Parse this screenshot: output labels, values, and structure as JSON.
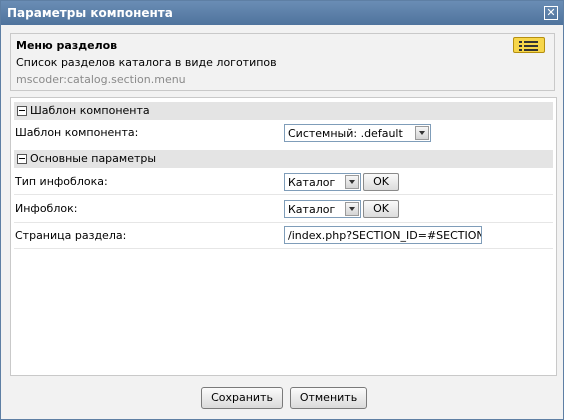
{
  "window": {
    "title": "Параметры компонента",
    "close_glyph": "✕"
  },
  "component": {
    "name": "Меню разделов",
    "description": "Список разделов каталога в виде логотипов",
    "code": "mscoder:catalog.section.menu"
  },
  "groups": [
    {
      "label": "Шаблон компонента",
      "params": [
        {
          "label": "Шаблон компонента:",
          "type": "select",
          "value": "Системный: .default"
        }
      ]
    },
    {
      "label": "Основные параметры",
      "params": [
        {
          "label": "Тип инфоблока:",
          "type": "select_ok",
          "value": "Каталог",
          "button": "OK"
        },
        {
          "label": "Инфоблок:",
          "type": "select_ok",
          "value": "Каталог",
          "button": "OK"
        },
        {
          "label": "Страница раздела:",
          "type": "text",
          "value": "/index.php?SECTION_ID=#SECTION_ID#"
        }
      ]
    }
  ],
  "footer": {
    "save_label": "Сохранить",
    "cancel_label": "Отменить"
  },
  "icons": {
    "close": "close-icon",
    "component_list": "list-icon",
    "collapse": "collapse-icon",
    "dropdown": "chevron-down-icon"
  },
  "colors": {
    "titlebar": "#5a7ea8",
    "section_header": "#e4e4e4",
    "panel_bg": "#f2f2f2",
    "list_icon": "#f7d64a"
  }
}
